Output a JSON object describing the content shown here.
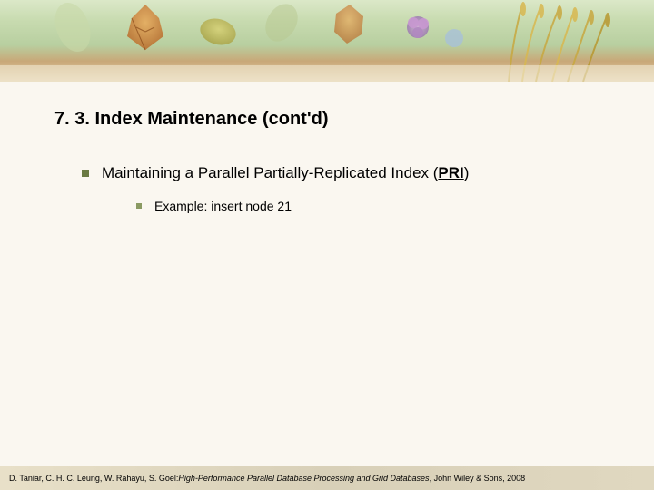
{
  "title": "7. 3. Index Maintenance (cont'd)",
  "item1_prefix": "Maintaining a Parallel Partially-Replicated Index (",
  "item1_acronym": "PRI",
  "item1_suffix": ")",
  "item2": "Example: insert node 21",
  "footer_authors": "D. Taniar, C. H. C. Leung, W. Rahayu, S. Goel: ",
  "footer_title": "High-Performance Parallel Database Processing and Grid Databases",
  "footer_pub": ", John Wiley & Sons, 2008"
}
